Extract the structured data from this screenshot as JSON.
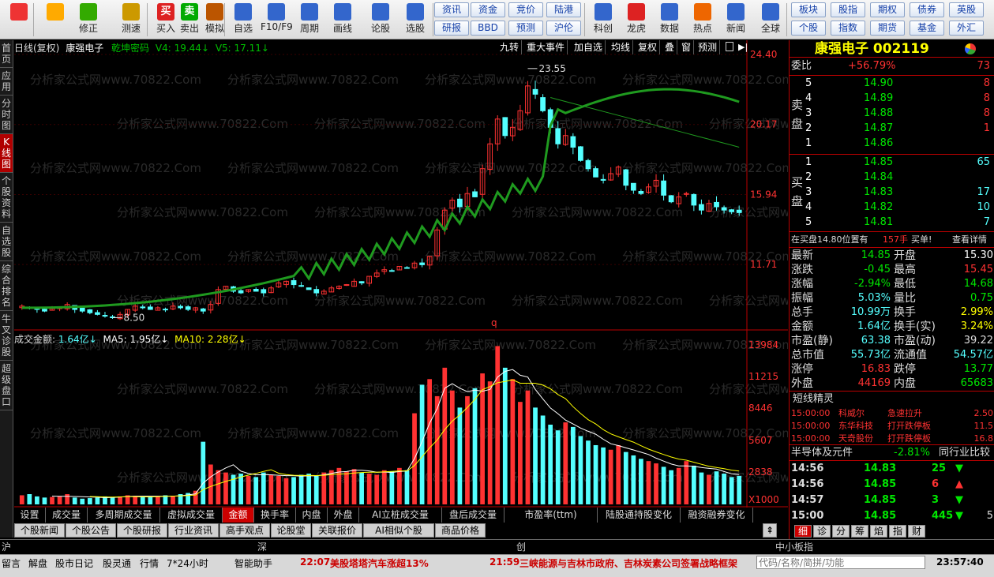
{
  "toolbar": {
    "items": [
      {
        "label": "",
        "icon": "logo-icon"
      },
      {
        "label": "",
        "icon": "back-arrow-icon"
      },
      {
        "label": "修正",
        "icon": "fix-icon"
      },
      {
        "label": "测速",
        "icon": "clock-icon"
      },
      {
        "label": "买入",
        "icon": "buy-icon",
        "glyph": "买"
      },
      {
        "label": "卖出",
        "icon": "sell-icon",
        "glyph": "卖"
      },
      {
        "label": "模拟",
        "icon": "hammer-icon"
      },
      {
        "label": "自选",
        "icon": "star-icon"
      },
      {
        "label": "F10/F9",
        "icon": "f10-icon"
      },
      {
        "label": "周期",
        "icon": "period-icon"
      },
      {
        "label": "画线",
        "icon": "pencil-icon"
      },
      {
        "label": "论股",
        "icon": "discuss-icon"
      },
      {
        "label": "选股",
        "icon": "pick-icon"
      }
    ],
    "mini_buttons": [
      "资讯",
      "资金",
      "竞价",
      "陆港",
      "研报",
      "BBD",
      "预测",
      "沪伦"
    ],
    "mid_items": [
      "科创",
      "龙虎",
      "数据",
      "热点",
      "新闻",
      "全球"
    ],
    "right_buttons": [
      "板块",
      "股指",
      "期权",
      "债券",
      "英股",
      "个股",
      "指数",
      "期货",
      "基金",
      "外汇"
    ]
  },
  "left_nav": [
    "首页",
    "应用",
    "分时图",
    "K线图",
    "个股资料",
    "自选股",
    "综合排名",
    "牛叉诊股",
    "超级盘口"
  ],
  "chart": {
    "header": {
      "title": "日线(复权)",
      "stock_name": "康强电子",
      "indicator": "乾坤密码",
      "v4": "V4: 19.44↓",
      "v5": "V5: 17.11↓"
    },
    "top_tools": [
      "九转",
      "重大事件",
      "加自选",
      "均线",
      "复权",
      "叠",
      "窗",
      "预测"
    ],
    "price_ticks": [
      "24.40",
      "20.17",
      "15.94",
      "11.71"
    ],
    "high_label": "23.55",
    "low_label": "8.50",
    "q_marker": "q",
    "volume_header": {
      "label": "成交金额:",
      "value": "1.64亿↓",
      "ma5": "MA5: 1.95亿↓",
      "ma10": "MA10: 2.28亿↓"
    },
    "volume_ticks": [
      "13984",
      "11215",
      "8446",
      "5607",
      "2838",
      "X1000"
    ],
    "watermark": "分析家公式网www.70822.Com"
  },
  "chart_data": {
    "type": "candlestick",
    "price_ylim": [
      8.0,
      24.4
    ],
    "high": 23.55,
    "low": 8.5,
    "closes": [
      9.2,
      9.1,
      9.0,
      8.9,
      9.05,
      9.1,
      9.3,
      9.0,
      8.9,
      8.8,
      8.7,
      8.6,
      8.5,
      8.7,
      9.0,
      9.2,
      9.1,
      9.0,
      9.1,
      9.0,
      9.2,
      9.1,
      9.0,
      9.1,
      8.9,
      9.3,
      10.2,
      10.4,
      10.1,
      10.0,
      10.2,
      10.1,
      10.0,
      10.3,
      10.6,
      10.7,
      10.5,
      10.4,
      10.2,
      10.0,
      10.1,
      10.3,
      10.4,
      10.5,
      10.7,
      10.6,
      11.0,
      11.2,
      11.4,
      11.3,
      11.6,
      11.5,
      11.8,
      11.7,
      12.2,
      13.8,
      15.0,
      15.6,
      15.2,
      16.0,
      15.8,
      17.5,
      19.0,
      20.5,
      19.5,
      20.0,
      21.0,
      22.5,
      22.0,
      21.0,
      20.0,
      19.0,
      19.5,
      18.8,
      18.0,
      17.5,
      17.0,
      16.8,
      17.2,
      17.6,
      16.5,
      16.2,
      16.0,
      16.4,
      16.8,
      15.9,
      15.5,
      15.8,
      16.0,
      15.3,
      15.0,
      15.4,
      15.2,
      15.0,
      14.9,
      14.85
    ],
    "volume_ylim": [
      0,
      14000
    ],
    "volumes": [
      800,
      900,
      700,
      600,
      650,
      700,
      900,
      600,
      500,
      550,
      600,
      700,
      650,
      700,
      800,
      750,
      700,
      650,
      700,
      800,
      750,
      900,
      1000,
      1200,
      5500,
      3500,
      3000,
      2800,
      2600,
      2700,
      2500,
      2400,
      2800,
      2600,
      2500,
      2300,
      2400,
      2600,
      2700,
      2500,
      2800,
      3000,
      3200,
      2900,
      3100,
      2800,
      2700,
      2600,
      3000,
      2900,
      3200,
      3000,
      8000,
      10500,
      11000,
      9500,
      12000,
      10000,
      8500,
      9500,
      10200,
      11500,
      10800,
      13900,
      12000,
      11000,
      9000,
      10000,
      8500,
      7800,
      7000,
      6500,
      7200,
      6800,
      6000,
      5600,
      5200,
      5000,
      4800,
      5200,
      4600,
      4300,
      4000,
      3800,
      3600,
      3300,
      3000,
      3200,
      3800,
      3400,
      2800,
      2600,
      2900,
      2700,
      2400,
      2500
    ],
    "ma5_volume": "1.95亿",
    "ma10_volume": "2.28亿"
  },
  "side": {
    "stock_title": "康强电子 002119",
    "weibi_label": "委比",
    "weibi_value": "+56.79%",
    "weibi_right": "73",
    "sell_label": "卖盘",
    "buy_label": "买盘",
    "sell": [
      {
        "n": "5",
        "price": "14.90",
        "vol": "8"
      },
      {
        "n": "4",
        "price": "14.89",
        "vol": "8"
      },
      {
        "n": "3",
        "price": "14.88",
        "vol": "8"
      },
      {
        "n": "2",
        "price": "14.87",
        "vol": "1"
      },
      {
        "n": "1",
        "price": "14.86",
        "vol": ""
      }
    ],
    "buy": [
      {
        "n": "1",
        "price": "14.85",
        "vol": "65"
      },
      {
        "n": "2",
        "price": "14.84",
        "vol": ""
      },
      {
        "n": "3",
        "price": "14.83",
        "vol": "17"
      },
      {
        "n": "4",
        "price": "14.82",
        "vol": "10"
      },
      {
        "n": "5",
        "price": "14.81",
        "vol": "7"
      }
    ],
    "order_note": "在买盘14.80位置有",
    "order_size": "157手",
    "order_tag": "买单!",
    "order_link": "查看详情",
    "stats": [
      {
        "l": "最新",
        "v": "14.85",
        "l2": "开盘",
        "v2": "15.30"
      },
      {
        "l": "涨跌",
        "v": "-0.45",
        "l2": "最高",
        "v2": "15.45"
      },
      {
        "l": "涨幅",
        "v": "-2.94%",
        "l2": "最低",
        "v2": "14.68"
      },
      {
        "l": "振幅",
        "v": "5.03%",
        "l2": "量比",
        "v2": "0.75"
      },
      {
        "l": "总手",
        "v": "10.99万",
        "l2": "换手",
        "v2": "2.99%"
      },
      {
        "l": "金额",
        "v": "1.64亿",
        "l2": "换手(实)",
        "v2": "3.24%"
      },
      {
        "l": "市盈(静)",
        "v": "63.38",
        "l2": "市盈(动)",
        "v2": "39.22"
      },
      {
        "l": "总市值",
        "v": "55.73亿",
        "l2": "流通值",
        "v2": "54.57亿"
      },
      {
        "l": "涨停",
        "v": "16.83",
        "l2": "跌停",
        "v2": "13.77"
      },
      {
        "l": "外盘",
        "v": "44169",
        "l2": "内盘",
        "v2": "65683"
      }
    ],
    "short_title": "短线精灵",
    "short_rows": [
      {
        "t": "15:00:00",
        "name": "科威尔",
        "ev": "急速拉升",
        "val": "2.50"
      },
      {
        "t": "15:00:00",
        "name": "东华科技",
        "ev": "打开跌停板",
        "val": "11.5"
      },
      {
        "t": "15:00:00",
        "name": "天奇股份",
        "ev": "打开跌停板",
        "val": "16.8"
      }
    ],
    "sector_name": "半导体及元件",
    "sector_change": "-2.81%",
    "sector_link": "同行业比较",
    "ticks": [
      {
        "t": "14:56",
        "p": "14.83",
        "v": "25",
        "d": "down"
      },
      {
        "t": "14:56",
        "p": "14.85",
        "v": "6",
        "d": "up"
      },
      {
        "t": "14:57",
        "p": "14.85",
        "v": "3",
        "d": "down"
      },
      {
        "t": "15:00",
        "p": "14.85",
        "v": "445",
        "d": "down",
        "extra": "5"
      }
    ],
    "bottom_tabs": [
      "细",
      "诊",
      "分",
      "筹",
      "焰",
      "指",
      "财"
    ]
  },
  "bottom_tabs": [
    "设置",
    "成交量",
    "多周期成交量",
    "虚拟成交量",
    "金额",
    "换手率",
    "内盘",
    "外盘",
    "AI立桩成交量",
    "盘后成交量",
    "市盈率(ttm)",
    "陆股通持股变化",
    "融资融券变化"
  ],
  "info_tabs": [
    "个股新闻",
    "个股公告",
    "个股研报",
    "行业资讯",
    "高手观点",
    "论股堂",
    "关联报价",
    "AI相似个股",
    "商品价格"
  ],
  "index_bar": {
    "sh": "沪",
    "sz": "深",
    "cy": "创",
    "zxb": "中小板指"
  },
  "status_bar": {
    "items": [
      "留言",
      "解盘",
      "股市日记",
      "股灵通",
      "行情",
      "7*24小时",
      "智能助手"
    ],
    "news1_time": "22:07",
    "news1": "美股塔塔汽车涨超13%",
    "news2_time": "21:59",
    "news2": "三峡能源与吉林市政府、吉林炭素公司签署战略框架",
    "search_placeholder": "代码/名称/简拼/功能",
    "clock": "23:57:40"
  }
}
